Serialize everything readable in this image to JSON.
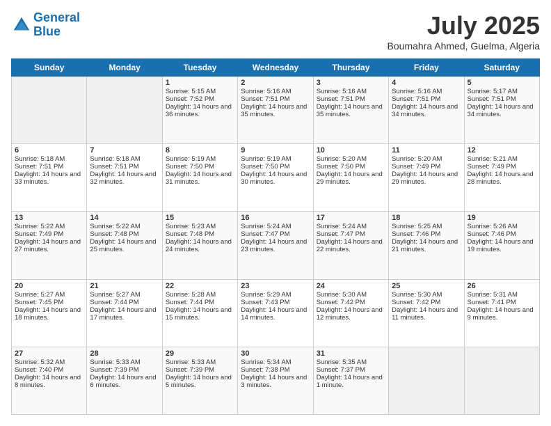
{
  "logo": {
    "line1": "General",
    "line2": "Blue"
  },
  "header": {
    "month": "July 2025",
    "location": "Boumahra Ahmed, Guelma, Algeria"
  },
  "weekdays": [
    "Sunday",
    "Monday",
    "Tuesday",
    "Wednesday",
    "Thursday",
    "Friday",
    "Saturday"
  ],
  "weeks": [
    [
      {
        "day": "",
        "sunrise": "",
        "sunset": "",
        "daylight": ""
      },
      {
        "day": "",
        "sunrise": "",
        "sunset": "",
        "daylight": ""
      },
      {
        "day": "1",
        "sunrise": "Sunrise: 5:15 AM",
        "sunset": "Sunset: 7:52 PM",
        "daylight": "Daylight: 14 hours and 36 minutes."
      },
      {
        "day": "2",
        "sunrise": "Sunrise: 5:16 AM",
        "sunset": "Sunset: 7:51 PM",
        "daylight": "Daylight: 14 hours and 35 minutes."
      },
      {
        "day": "3",
        "sunrise": "Sunrise: 5:16 AM",
        "sunset": "Sunset: 7:51 PM",
        "daylight": "Daylight: 14 hours and 35 minutes."
      },
      {
        "day": "4",
        "sunrise": "Sunrise: 5:16 AM",
        "sunset": "Sunset: 7:51 PM",
        "daylight": "Daylight: 14 hours and 34 minutes."
      },
      {
        "day": "5",
        "sunrise": "Sunrise: 5:17 AM",
        "sunset": "Sunset: 7:51 PM",
        "daylight": "Daylight: 14 hours and 34 minutes."
      }
    ],
    [
      {
        "day": "6",
        "sunrise": "Sunrise: 5:18 AM",
        "sunset": "Sunset: 7:51 PM",
        "daylight": "Daylight: 14 hours and 33 minutes."
      },
      {
        "day": "7",
        "sunrise": "Sunrise: 5:18 AM",
        "sunset": "Sunset: 7:51 PM",
        "daylight": "Daylight: 14 hours and 32 minutes."
      },
      {
        "day": "8",
        "sunrise": "Sunrise: 5:19 AM",
        "sunset": "Sunset: 7:50 PM",
        "daylight": "Daylight: 14 hours and 31 minutes."
      },
      {
        "day": "9",
        "sunrise": "Sunrise: 5:19 AM",
        "sunset": "Sunset: 7:50 PM",
        "daylight": "Daylight: 14 hours and 30 minutes."
      },
      {
        "day": "10",
        "sunrise": "Sunrise: 5:20 AM",
        "sunset": "Sunset: 7:50 PM",
        "daylight": "Daylight: 14 hours and 29 minutes."
      },
      {
        "day": "11",
        "sunrise": "Sunrise: 5:20 AM",
        "sunset": "Sunset: 7:49 PM",
        "daylight": "Daylight: 14 hours and 29 minutes."
      },
      {
        "day": "12",
        "sunrise": "Sunrise: 5:21 AM",
        "sunset": "Sunset: 7:49 PM",
        "daylight": "Daylight: 14 hours and 28 minutes."
      }
    ],
    [
      {
        "day": "13",
        "sunrise": "Sunrise: 5:22 AM",
        "sunset": "Sunset: 7:49 PM",
        "daylight": "Daylight: 14 hours and 27 minutes."
      },
      {
        "day": "14",
        "sunrise": "Sunrise: 5:22 AM",
        "sunset": "Sunset: 7:48 PM",
        "daylight": "Daylight: 14 hours and 25 minutes."
      },
      {
        "day": "15",
        "sunrise": "Sunrise: 5:23 AM",
        "sunset": "Sunset: 7:48 PM",
        "daylight": "Daylight: 14 hours and 24 minutes."
      },
      {
        "day": "16",
        "sunrise": "Sunrise: 5:24 AM",
        "sunset": "Sunset: 7:47 PM",
        "daylight": "Daylight: 14 hours and 23 minutes."
      },
      {
        "day": "17",
        "sunrise": "Sunrise: 5:24 AM",
        "sunset": "Sunset: 7:47 PM",
        "daylight": "Daylight: 14 hours and 22 minutes."
      },
      {
        "day": "18",
        "sunrise": "Sunrise: 5:25 AM",
        "sunset": "Sunset: 7:46 PM",
        "daylight": "Daylight: 14 hours and 21 minutes."
      },
      {
        "day": "19",
        "sunrise": "Sunrise: 5:26 AM",
        "sunset": "Sunset: 7:46 PM",
        "daylight": "Daylight: 14 hours and 19 minutes."
      }
    ],
    [
      {
        "day": "20",
        "sunrise": "Sunrise: 5:27 AM",
        "sunset": "Sunset: 7:45 PM",
        "daylight": "Daylight: 14 hours and 18 minutes."
      },
      {
        "day": "21",
        "sunrise": "Sunrise: 5:27 AM",
        "sunset": "Sunset: 7:44 PM",
        "daylight": "Daylight: 14 hours and 17 minutes."
      },
      {
        "day": "22",
        "sunrise": "Sunrise: 5:28 AM",
        "sunset": "Sunset: 7:44 PM",
        "daylight": "Daylight: 14 hours and 15 minutes."
      },
      {
        "day": "23",
        "sunrise": "Sunrise: 5:29 AM",
        "sunset": "Sunset: 7:43 PM",
        "daylight": "Daylight: 14 hours and 14 minutes."
      },
      {
        "day": "24",
        "sunrise": "Sunrise: 5:30 AM",
        "sunset": "Sunset: 7:42 PM",
        "daylight": "Daylight: 14 hours and 12 minutes."
      },
      {
        "day": "25",
        "sunrise": "Sunrise: 5:30 AM",
        "sunset": "Sunset: 7:42 PM",
        "daylight": "Daylight: 14 hours and 11 minutes."
      },
      {
        "day": "26",
        "sunrise": "Sunrise: 5:31 AM",
        "sunset": "Sunset: 7:41 PM",
        "daylight": "Daylight: 14 hours and 9 minutes."
      }
    ],
    [
      {
        "day": "27",
        "sunrise": "Sunrise: 5:32 AM",
        "sunset": "Sunset: 7:40 PM",
        "daylight": "Daylight: 14 hours and 8 minutes."
      },
      {
        "day": "28",
        "sunrise": "Sunrise: 5:33 AM",
        "sunset": "Sunset: 7:39 PM",
        "daylight": "Daylight: 14 hours and 6 minutes."
      },
      {
        "day": "29",
        "sunrise": "Sunrise: 5:33 AM",
        "sunset": "Sunset: 7:39 PM",
        "daylight": "Daylight: 14 hours and 5 minutes."
      },
      {
        "day": "30",
        "sunrise": "Sunrise: 5:34 AM",
        "sunset": "Sunset: 7:38 PM",
        "daylight": "Daylight: 14 hours and 3 minutes."
      },
      {
        "day": "31",
        "sunrise": "Sunrise: 5:35 AM",
        "sunset": "Sunset: 7:37 PM",
        "daylight": "Daylight: 14 hours and 1 minute."
      },
      {
        "day": "",
        "sunrise": "",
        "sunset": "",
        "daylight": ""
      },
      {
        "day": "",
        "sunrise": "",
        "sunset": "",
        "daylight": ""
      }
    ]
  ]
}
